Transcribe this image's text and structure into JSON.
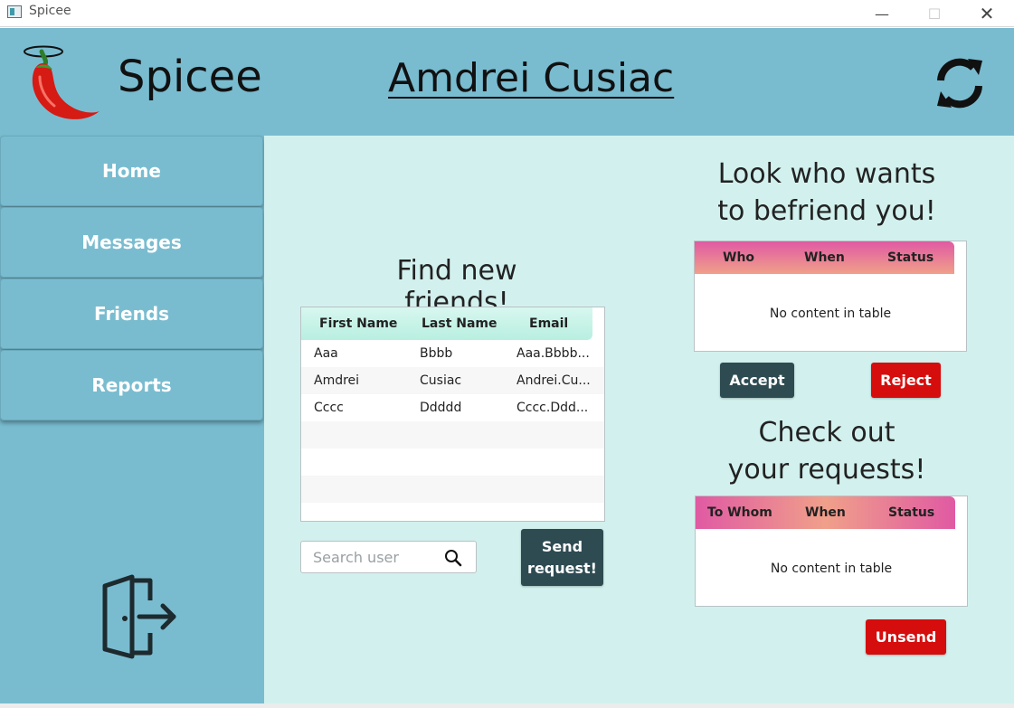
{
  "window": {
    "title": "Spicee",
    "minimize": "—",
    "maximize": "☐",
    "close": "✕"
  },
  "header": {
    "brand": "Spicee",
    "username": "Amdrei Cusiac"
  },
  "sidebar": {
    "items": [
      {
        "label": "Home"
      },
      {
        "label": "Messages"
      },
      {
        "label": "Friends"
      },
      {
        "label": "Reports"
      }
    ]
  },
  "find": {
    "title": "Find new friends!",
    "columns": [
      "First Name",
      "Last Name",
      "Email"
    ],
    "rows": [
      [
        "Aaa",
        "Bbbb",
        "Aaa.Bbbb..."
      ],
      [
        "Amdrei",
        "Cusiac",
        "Andrei.Cu..."
      ],
      [
        "Cccc",
        "Ddddd",
        "Cccc.Ddd..."
      ]
    ],
    "search_placeholder": "Search user",
    "send_line1": "Send",
    "send_line2": "request!"
  },
  "incoming": {
    "title_line1": "Look who wants",
    "title_line2": "to befriend you!",
    "columns": [
      "Who",
      "When",
      "Status"
    ],
    "empty": "No content in table",
    "accept": "Accept",
    "reject": "Reject"
  },
  "outgoing": {
    "title_line1": "Check out",
    "title_line2": "your requests!",
    "columns": [
      "To Whom",
      "When",
      "Status"
    ],
    "empty": "No content in table",
    "unsend": "Unsend"
  },
  "colors": {
    "header": "#79bcd0",
    "main_bg": "#d2f1ee",
    "dark_button": "#2e4b52",
    "red_button": "#d50d0d",
    "pink_header_start": "#e05aa3",
    "pink_header_end": "#f0a08a",
    "mint_header": "#c7f4e8"
  }
}
